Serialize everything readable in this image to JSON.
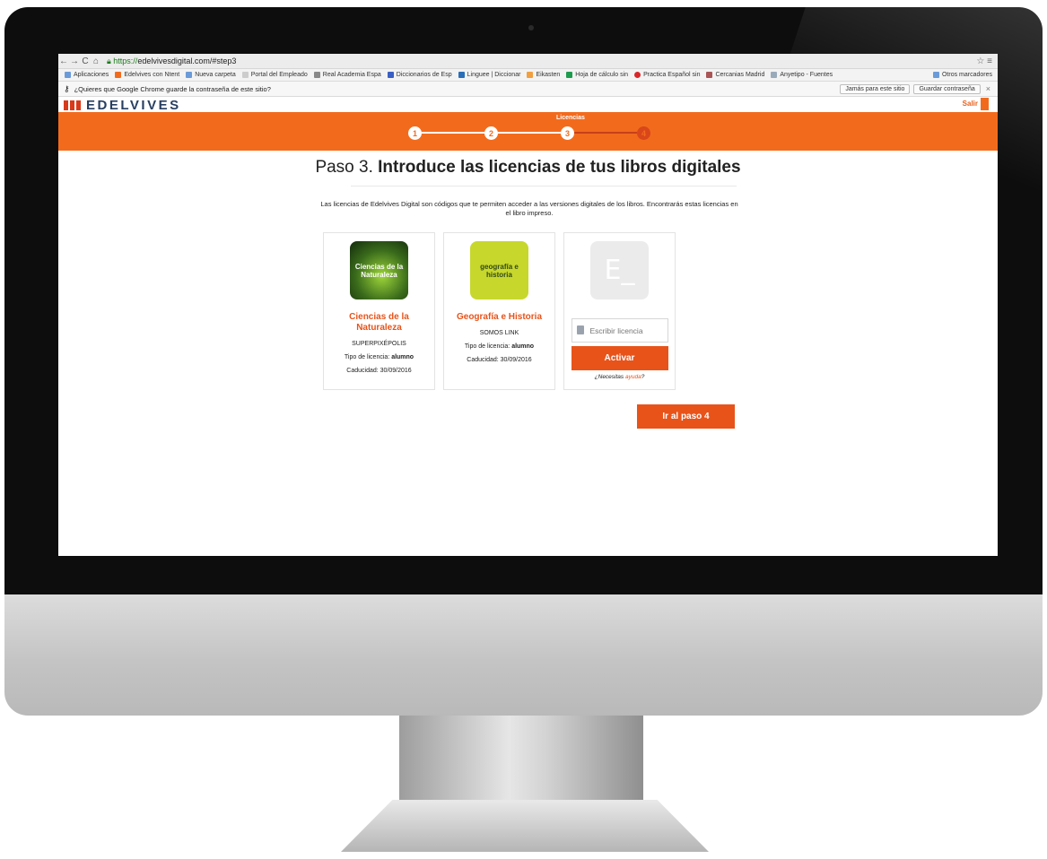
{
  "browser": {
    "url_scheme": "https://",
    "url_host": "edelvivesdigital.com",
    "url_path": "/#step3",
    "bookmarks": [
      "Aplicaciones",
      "Edelvives con Ntent",
      "Nueva carpeta",
      "Portal del Empleado",
      "Real Academia Espa",
      "Diccionarios de Esp",
      "Linguee | Diccionar",
      "Eikasten",
      "Hoja de cálculo sin",
      "Practica Español sin",
      "Cercanias Madrid",
      "Anyetipo - Fuentes"
    ],
    "other_bookmarks": "Otros marcadores",
    "password_prompt": "¿Quieres que Google Chrome guarde la contraseña de este sitio?",
    "never_button": "Jamás para este sitio",
    "save_password_button": "Guardar contraseña",
    "close_glyph": "×"
  },
  "site": {
    "logo": "EDELVIVES",
    "logout": "Salir"
  },
  "steps": {
    "current_label": "Licencias",
    "items": [
      "1",
      "2",
      "3",
      "4"
    ],
    "current": 3
  },
  "main": {
    "title_prefix": "Paso 3.",
    "title_bold": "Introduce las licencias de tus libros digitales",
    "intro": "Las licencias de Edelvives Digital son códigos que te permiten acceder a las versiones digitales de los libros. Encontrarás estas licencias en el libro impreso.",
    "next_button": "Ir al paso 4"
  },
  "books": [
    {
      "cover_text": "Ciencias de la Naturaleza",
      "title": "Ciencias de la Naturaleza",
      "series": "SUPERPIXÉPOLIS",
      "license_label": "Tipo de licencia:",
      "license_value": "alumno",
      "expiry": "Caducidad: 30/09/2016"
    },
    {
      "cover_text": "geografía e historia",
      "title": "Geografía e Historia",
      "series": "SOMOS LINK",
      "license_label": "Tipo de licencia:",
      "license_value": "alumno",
      "expiry": "Caducidad: 30/09/2016"
    }
  ],
  "license_form": {
    "cover_glyph": "E_",
    "placeholder": "Escribir licencia",
    "button": "Activar",
    "help_prefix": "¿Necesitas",
    "help_link": "ayuda",
    "help_suffix": "?"
  },
  "colors": {
    "accent": "#f26b1d",
    "button": "#e8531a",
    "logo_text": "#283f61"
  }
}
